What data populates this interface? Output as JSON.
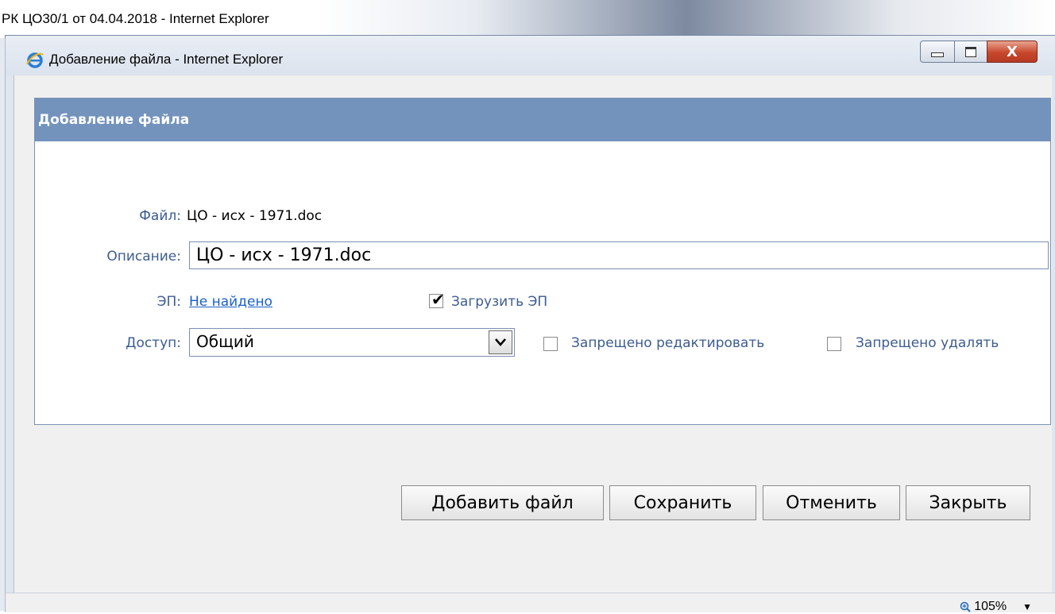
{
  "parent_window": {
    "title": "РК ЦО30/1 от 04.04.2018 - Internet Explorer"
  },
  "dialog_window": {
    "title": "Добавление файла - Internet Explorer",
    "controls": {
      "close_glyph": "X"
    }
  },
  "panel": {
    "header": "Добавление файла",
    "file": {
      "label": "Файл:",
      "value": "ЦО - исх - 1971.doc"
    },
    "description": {
      "label": "Описание:",
      "value": "ЦО - исх - 1971.doc"
    },
    "signature": {
      "label": "ЭП:",
      "link": "Не найдено",
      "upload_checkbox": {
        "label": "Загрузить ЭП",
        "checked": true
      }
    },
    "access": {
      "label": "Доступ:",
      "selected": "Общий",
      "no_edit": {
        "label": "Запрещено редактировать",
        "checked": false
      },
      "no_delete": {
        "label": "Запрещено удалять",
        "checked": false
      }
    }
  },
  "buttons": {
    "add_file": "Добавить файл",
    "save": "Сохранить",
    "cancel": "Отменить",
    "close": "Закрыть"
  },
  "statusbar": {
    "zoom": "105%"
  },
  "icons": {
    "ie": "internet-explorer-icon",
    "zoom": "zoom-icon",
    "dropdown": "chevron-down-icon",
    "check": "checkmark-icon"
  },
  "colors": {
    "panel_header": "#7393bd",
    "label_text": "#3d5c8f",
    "link": "#1a5fc9",
    "close_button": "#c8472c"
  }
}
